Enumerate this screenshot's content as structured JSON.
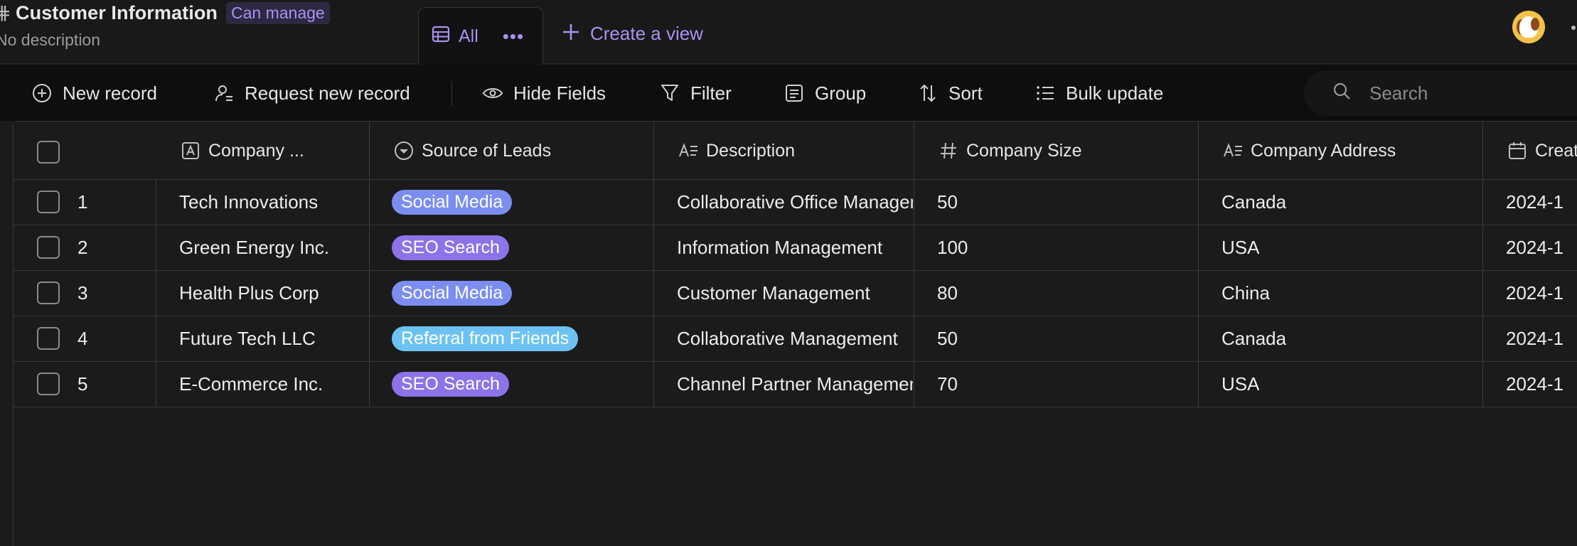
{
  "header": {
    "title": "Customer Information",
    "permission": "Can manage",
    "description": "No description",
    "view_tab_label": "All",
    "view_tab_more": "•••",
    "create_view_label": "Create a view"
  },
  "toolbar": {
    "new_record": "New record",
    "request_new_record": "Request new record",
    "hide_fields": "Hide Fields",
    "filter": "Filter",
    "group": "Group",
    "sort": "Sort",
    "bulk_update": "Bulk update",
    "search_placeholder": "Search"
  },
  "columns": {
    "company": "Company ...",
    "source": "Source of Leads",
    "description": "Description",
    "size": "Company Size",
    "address": "Company Address",
    "created": "Created"
  },
  "colors": {
    "accent": "#a991f2",
    "tag_social_media": "#7b8ef0",
    "tag_seo_search": "#8c73ea",
    "tag_referral": "#6cc3f3"
  },
  "rows": [
    {
      "index": "1",
      "company": "Tech Innovations",
      "source": "Social Media",
      "description": "Collaborative Office Management",
      "size": "50",
      "address": "Canada",
      "created": "2024-1"
    },
    {
      "index": "2",
      "company": "Green Energy Inc.",
      "source": "SEO Search",
      "description": "Information Management",
      "size": "100",
      "address": "USA",
      "created": "2024-1"
    },
    {
      "index": "3",
      "company": "Health Plus Corp",
      "source": "Social Media",
      "description": "Customer Management",
      "size": "80",
      "address": "China",
      "created": "2024-1"
    },
    {
      "index": "4",
      "company": "Future Tech LLC",
      "source": "Referral from Friends",
      "description": "Collaborative Management",
      "size": "50",
      "address": "Canada",
      "created": "2024-1"
    },
    {
      "index": "5",
      "company": "E-Commerce Inc.",
      "source": "SEO Search",
      "description": "Channel Partner Management",
      "size": "70",
      "address": "USA",
      "created": "2024-1"
    }
  ]
}
